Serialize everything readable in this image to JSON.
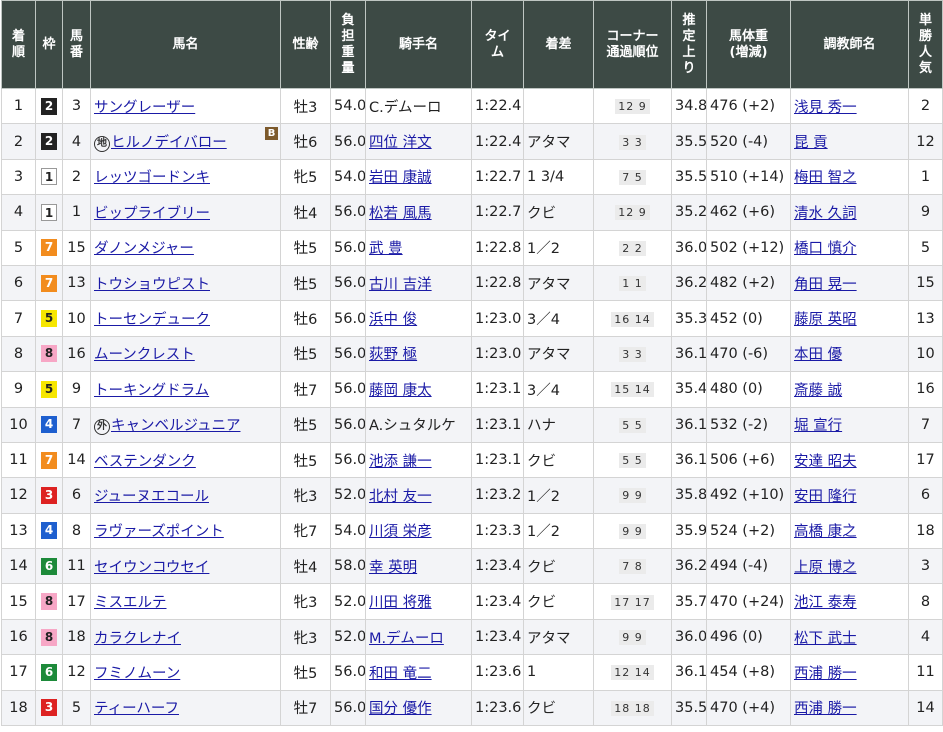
{
  "headers": {
    "rank": "着\n順",
    "waku": "枠",
    "umaban": "馬\n番",
    "horse": "馬名",
    "sexage": "性齢",
    "weight": "負\n担\n重\n量",
    "jockey": "騎手名",
    "time": "タイ\nム",
    "margin": "着差",
    "corner": "コーナー\n通過順位",
    "last3f": "推\n定\n上\nり",
    "bodyweight": "馬体重\n(増減)",
    "trainer": "調教師名",
    "popularity": "単\n勝\n人\n気"
  },
  "rows": [
    {
      "rank": "1",
      "waku": "2",
      "umaban": "3",
      "badge": "",
      "horse": "サングレーザー",
      "blinker": "",
      "sexage": "牡3",
      "weight": "54.0",
      "jockey": "C.デムーロ",
      "jockey_link": false,
      "time": "1:22.4",
      "margin": "",
      "corner": "12 9",
      "last3f": "34.8",
      "bodyweight": "476 (+2)",
      "trainer": "浅見 秀一",
      "popularity": "2"
    },
    {
      "rank": "2",
      "waku": "2",
      "umaban": "4",
      "badge": "地",
      "horse": "ヒルノデイバロー",
      "blinker": "B",
      "sexage": "牡6",
      "weight": "56.0",
      "jockey": "四位 洋文",
      "jockey_link": true,
      "time": "1:22.4",
      "margin": "アタマ",
      "corner": "3 3",
      "last3f": "35.5",
      "bodyweight": "520 (-4)",
      "trainer": "昆 貢",
      "popularity": "12"
    },
    {
      "rank": "3",
      "waku": "1",
      "umaban": "2",
      "badge": "",
      "horse": "レッツゴードンキ",
      "blinker": "",
      "sexage": "牝5",
      "weight": "54.0",
      "jockey": "岩田 康誠",
      "jockey_link": true,
      "time": "1:22.7",
      "margin": "1 3/4",
      "corner": "7 5",
      "last3f": "35.5",
      "bodyweight": "510 (+14)",
      "trainer": "梅田 智之",
      "popularity": "1"
    },
    {
      "rank": "4",
      "waku": "1",
      "umaban": "1",
      "badge": "",
      "horse": "ビップライブリー",
      "blinker": "",
      "sexage": "牡4",
      "weight": "56.0",
      "jockey": "松若 風馬",
      "jockey_link": true,
      "time": "1:22.7",
      "margin": "クビ",
      "corner": "12 9",
      "last3f": "35.2",
      "bodyweight": "462 (+6)",
      "trainer": "清水 久詞",
      "popularity": "9"
    },
    {
      "rank": "5",
      "waku": "7",
      "umaban": "15",
      "badge": "",
      "horse": "ダノンメジャー",
      "blinker": "",
      "sexage": "牡5",
      "weight": "56.0",
      "jockey": "武 豊",
      "jockey_link": true,
      "time": "1:22.8",
      "margin": "1／2",
      "corner": "2 2",
      "last3f": "36.0",
      "bodyweight": "502 (+12)",
      "trainer": "橋口 慎介",
      "popularity": "5"
    },
    {
      "rank": "6",
      "waku": "7",
      "umaban": "13",
      "badge": "",
      "horse": "トウショウピスト",
      "blinker": "",
      "sexage": "牡5",
      "weight": "56.0",
      "jockey": "古川 吉洋",
      "jockey_link": true,
      "time": "1:22.8",
      "margin": "アタマ",
      "corner": "1 1",
      "last3f": "36.2",
      "bodyweight": "482 (+2)",
      "trainer": "角田 晃一",
      "popularity": "15"
    },
    {
      "rank": "7",
      "waku": "5",
      "umaban": "10",
      "badge": "",
      "horse": "トーセンデューク",
      "blinker": "",
      "sexage": "牡6",
      "weight": "56.0",
      "jockey": "浜中 俊",
      "jockey_link": true,
      "time": "1:23.0",
      "margin": "3／4",
      "corner": "16 14",
      "last3f": "35.3",
      "bodyweight": "452 (0)",
      "trainer": "藤原 英昭",
      "popularity": "13"
    },
    {
      "rank": "8",
      "waku": "8",
      "umaban": "16",
      "badge": "",
      "horse": "ムーンクレスト",
      "blinker": "",
      "sexage": "牡5",
      "weight": "56.0",
      "jockey": "荻野 極",
      "jockey_link": true,
      "time": "1:23.0",
      "margin": "アタマ",
      "corner": "3 3",
      "last3f": "36.1",
      "bodyweight": "470 (-6)",
      "trainer": "本田 優",
      "popularity": "10"
    },
    {
      "rank": "9",
      "waku": "5",
      "umaban": "9",
      "badge": "",
      "horse": "トーキングドラム",
      "blinker": "",
      "sexage": "牡7",
      "weight": "56.0",
      "jockey": "藤岡 康太",
      "jockey_link": true,
      "time": "1:23.1",
      "margin": "3／4",
      "corner": "15 14",
      "last3f": "35.4",
      "bodyweight": "480 (0)",
      "trainer": "斎藤 誠",
      "popularity": "16"
    },
    {
      "rank": "10",
      "waku": "4",
      "umaban": "7",
      "badge": "外",
      "horse": "キャンベルジュニア",
      "blinker": "",
      "sexage": "牡5",
      "weight": "56.0",
      "jockey": "A.シュタルケ",
      "jockey_link": false,
      "time": "1:23.1",
      "margin": "ハナ",
      "corner": "5 5",
      "last3f": "36.1",
      "bodyweight": "532 (-2)",
      "trainer": "堀 宣行",
      "popularity": "7"
    },
    {
      "rank": "11",
      "waku": "7",
      "umaban": "14",
      "badge": "",
      "horse": "ベステンダンク",
      "blinker": "",
      "sexage": "牡5",
      "weight": "56.0",
      "jockey": "池添 謙一",
      "jockey_link": true,
      "time": "1:23.1",
      "margin": "クビ",
      "corner": "5 5",
      "last3f": "36.1",
      "bodyweight": "506 (+6)",
      "trainer": "安達 昭夫",
      "popularity": "17"
    },
    {
      "rank": "12",
      "waku": "3",
      "umaban": "6",
      "badge": "",
      "horse": "ジューヌエコール",
      "blinker": "",
      "sexage": "牝3",
      "weight": "52.0",
      "jockey": "北村 友一",
      "jockey_link": true,
      "time": "1:23.2",
      "margin": "1／2",
      "corner": "9 9",
      "last3f": "35.8",
      "bodyweight": "492 (+10)",
      "trainer": "安田 隆行",
      "popularity": "6"
    },
    {
      "rank": "13",
      "waku": "4",
      "umaban": "8",
      "badge": "",
      "horse": "ラヴァーズポイント",
      "blinker": "",
      "sexage": "牝7",
      "weight": "54.0",
      "jockey": "川須 栄彦",
      "jockey_link": true,
      "time": "1:23.3",
      "margin": "1／2",
      "corner": "9 9",
      "last3f": "35.9",
      "bodyweight": "524 (+2)",
      "trainer": "高橋 康之",
      "popularity": "18"
    },
    {
      "rank": "14",
      "waku": "6",
      "umaban": "11",
      "badge": "",
      "horse": "セイウンコウセイ",
      "blinker": "",
      "sexage": "牡4",
      "weight": "58.0",
      "jockey": "幸 英明",
      "jockey_link": true,
      "time": "1:23.4",
      "margin": "クビ",
      "corner": "7 8",
      "last3f": "36.2",
      "bodyweight": "494 (-4)",
      "trainer": "上原 博之",
      "popularity": "3"
    },
    {
      "rank": "15",
      "waku": "8",
      "umaban": "17",
      "badge": "",
      "horse": "ミスエルテ",
      "blinker": "",
      "sexage": "牝3",
      "weight": "52.0",
      "jockey": "川田 将雅",
      "jockey_link": true,
      "time": "1:23.4",
      "margin": "クビ",
      "corner": "17 17",
      "last3f": "35.7",
      "bodyweight": "470 (+24)",
      "trainer": "池江 泰寿",
      "popularity": "8"
    },
    {
      "rank": "16",
      "waku": "8",
      "umaban": "18",
      "badge": "",
      "horse": "カラクレナイ",
      "blinker": "",
      "sexage": "牝3",
      "weight": "52.0",
      "jockey": "M.デムーロ",
      "jockey_link": true,
      "time": "1:23.4",
      "margin": "アタマ",
      "corner": "9 9",
      "last3f": "36.0",
      "bodyweight": "496 (0)",
      "trainer": "松下 武士",
      "popularity": "4"
    },
    {
      "rank": "17",
      "waku": "6",
      "umaban": "12",
      "badge": "",
      "horse": "フミノムーン",
      "blinker": "",
      "sexage": "牡5",
      "weight": "56.0",
      "jockey": "和田 竜二",
      "jockey_link": true,
      "time": "1:23.6",
      "margin": "1",
      "corner": "12 14",
      "last3f": "36.1",
      "bodyweight": "454 (+8)",
      "trainer": "西浦 勝一",
      "popularity": "11"
    },
    {
      "rank": "18",
      "waku": "3",
      "umaban": "5",
      "badge": "",
      "horse": "ティーハーフ",
      "blinker": "",
      "sexage": "牡7",
      "weight": "56.0",
      "jockey": "国分 優作",
      "jockey_link": true,
      "time": "1:23.6",
      "margin": "クビ",
      "corner": "18 18",
      "last3f": "35.5",
      "bodyweight": "470 (+4)",
      "trainer": "西浦 勝一",
      "popularity": "14"
    }
  ]
}
